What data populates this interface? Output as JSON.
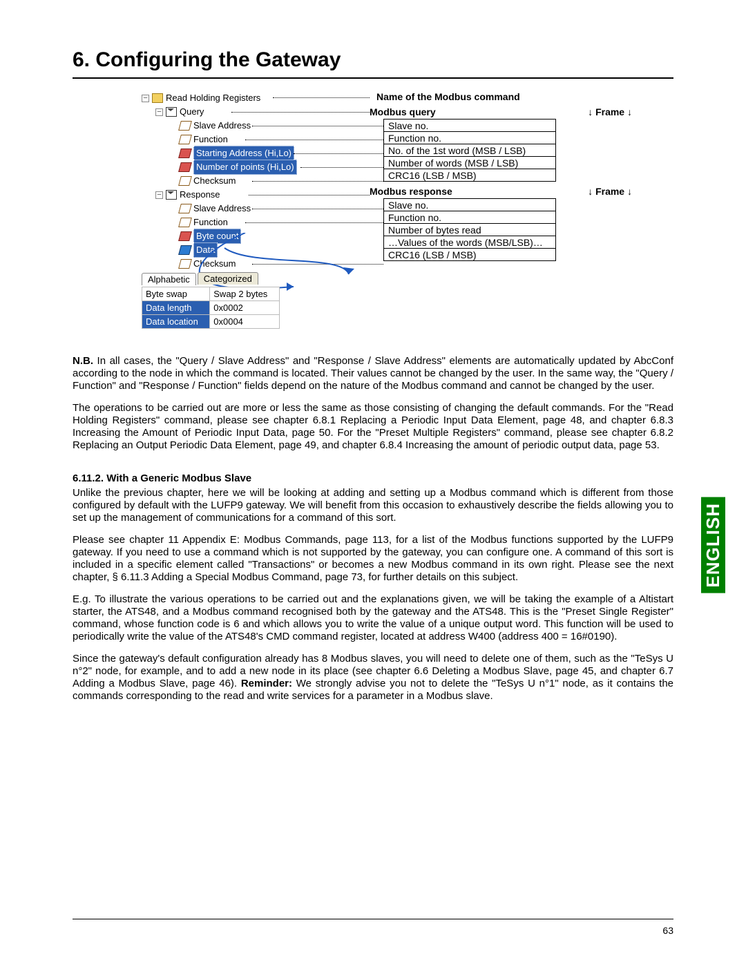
{
  "title": "6. Configuring the Gateway",
  "pageNumber": "63",
  "languageTab": "ENGLISH",
  "diagram": {
    "commandNameLabel": "Name of the Modbus command",
    "queryHeader": "Modbus query",
    "responseHeader": "Modbus response",
    "frameLabel": "↓ Frame ↓",
    "queryRows": [
      "Slave no.",
      "Function no.",
      "No. of the 1st word (MSB / LSB)",
      "Number of words (MSB / LSB)",
      "CRC16 (LSB / MSB)"
    ],
    "responseRows": [
      "Slave no.",
      "Function no.",
      "Number of bytes read",
      "…Values of the words (MSB/LSB)…",
      "CRC16 (LSB / MSB)"
    ],
    "tree": {
      "root": "Read Holding Registers",
      "query": "Query",
      "response": "Response",
      "qItems": [
        "Slave Address",
        "Function",
        "Starting Address (Hi,Lo)",
        "Number of points (Hi,Lo)",
        "Checksum"
      ],
      "rItems": [
        "Slave Address",
        "Function",
        "Byte count",
        "Data",
        "Checksum"
      ]
    },
    "tabs": {
      "alphabetic": "Alphabetic",
      "categorized": "Categorized"
    },
    "props": [
      {
        "k": "Byte swap",
        "v": "Swap 2 bytes"
      },
      {
        "k": "Data length",
        "v": "0x0002"
      },
      {
        "k": "Data location",
        "v": "0x0004"
      }
    ]
  },
  "paragraphs": {
    "nbLabel": "N.B.",
    "nb": "In all cases, the \"Query / Slave Address\" and \"Response / Slave Address\" elements are automatically updated by AbcConf according to the node in which the command is located. Their values cannot be changed by the user. In the same way, the \"Query / Function\" and \"Response / Function\" fields depend on the nature of the Modbus command and cannot be changed by the user.",
    "ops": "The operations to be carried out are more or less the same as those consisting of changing the default commands. For the \"Read Holding Registers\" command, please see chapter 6.8.1 Replacing a Periodic Input Data Element, page 48, and chapter 6.8.3 Increasing the Amount of Periodic Input Data, page 50. For the \"Preset Multiple Registers\" command, please see chapter 6.8.2 Replacing an Output Periodic Data Element, page 49, and chapter 6.8.4 Increasing the amount of periodic output data, page 53.",
    "subhead": "6.11.2. With a Generic Modbus Slave",
    "p1": "Unlike the previous chapter, here we will be looking at adding and setting up a Modbus command which is different from those configured by default with the LUFP9 gateway. We will benefit from this occasion to exhaustively describe the fields allowing you to set up the management of communications for a command of this sort.",
    "p2": "Please see chapter 11 Appendix E: Modbus Commands, page 113, for a list of the Modbus functions supported by the LUFP9 gateway. If you need to use a command which is not supported by the gateway, you can configure one. A command of this sort is included in a specific element called \"Transactions\" or becomes a new Modbus command in its own right. Please see the next chapter, § 6.11.3 Adding a Special Modbus Command, page 73, for further details on this subject.",
    "p3": "E.g. To illustrate the various operations to be carried out and the explanations given, we will be taking the example of a Altistart starter, the ATS48, and a Modbus command recognised both by the gateway and the ATS48. This is the \"Preset Single Register\" command, whose function code is 6 and which allows you to write the value of a unique output word. This function will be used to periodically write the value of the ATS48's CMD command register, located at address W400 (address 400 = 16#0190).",
    "reminderLabel": "Reminder:",
    "p4a": "Since the gateway's default configuration already has 8 Modbus slaves, you will need to delete one of them, such as the \"TeSys U n°2\" node, for example, and to add a new node in its place (see chapter 6.6 Deleting a Modbus Slave, page 45, and chapter 6.7 Adding a Modbus Slave, page 46). ",
    "p4b": " We strongly advise you not to delete the \"TeSys U n°1\" node, as it contains the commands corresponding to the read and write services for a parameter in a Modbus slave."
  }
}
